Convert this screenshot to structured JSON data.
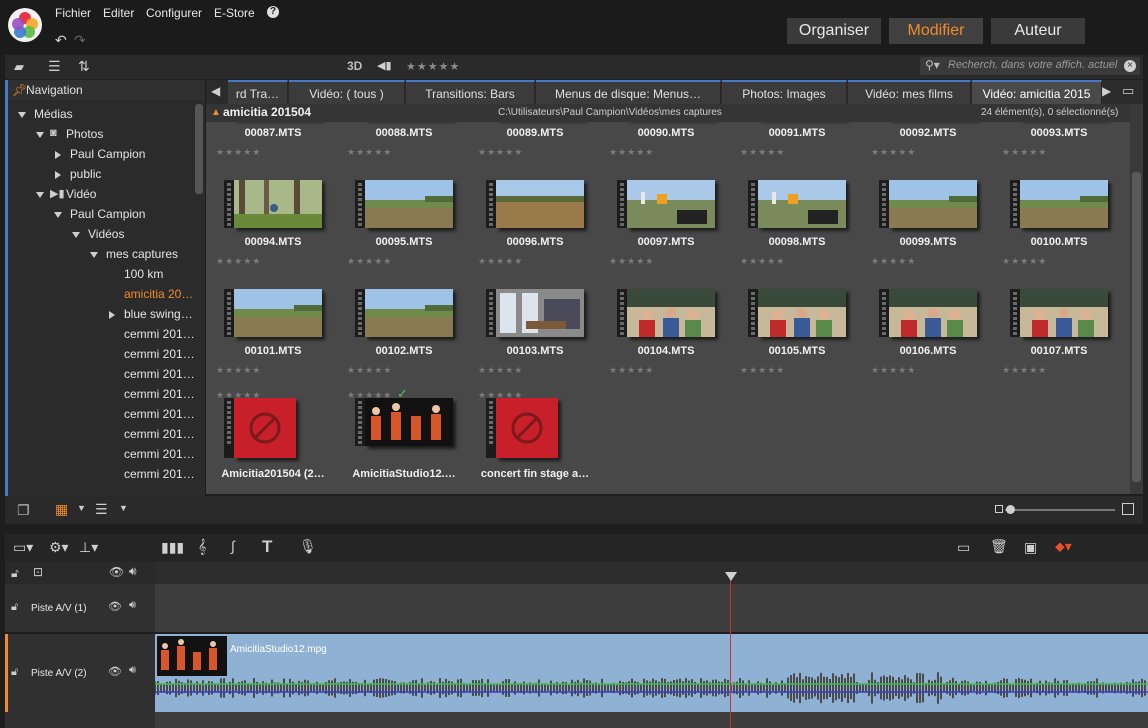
{
  "menu": [
    "Fichier",
    "Editer",
    "Configurer",
    "E-Store"
  ],
  "modes": {
    "organiser": "Organiser",
    "modifier": "Modifier",
    "auteur": "Auteur"
  },
  "toolbar": {
    "label_3d": "3D",
    "stars": "★★★★★"
  },
  "search": {
    "placeholder": "Recherch. dans votre affich. actuel"
  },
  "navigation": {
    "title": "Navigation",
    "rows": [
      {
        "label": "Médias",
        "indent": 0,
        "expand": "down",
        "icon": "none"
      },
      {
        "label": "Photos",
        "indent": 1,
        "expand": "down",
        "icon": "camera-icon"
      },
      {
        "label": "Paul Campion",
        "indent": 2,
        "expand": "right",
        "icon": "none"
      },
      {
        "label": "public",
        "indent": 2,
        "expand": "right",
        "icon": "none"
      },
      {
        "label": "Vidéo",
        "indent": 1,
        "expand": "down",
        "icon": "video-icon"
      },
      {
        "label": "Paul Campion",
        "indent": 2,
        "expand": "down",
        "icon": "none"
      },
      {
        "label": "Vidéos",
        "indent": 3,
        "expand": "down",
        "icon": "none"
      },
      {
        "label": "mes captures",
        "indent": 4,
        "expand": "down",
        "icon": "none"
      },
      {
        "label": "100 km",
        "indent": 5,
        "expand": "none",
        "icon": "none"
      },
      {
        "label": "amicitia 20…",
        "indent": 5,
        "expand": "none",
        "icon": "none",
        "selected": true
      },
      {
        "label": "blue swing…",
        "indent": 5,
        "expand": "right",
        "icon": "none"
      },
      {
        "label": "cemmi 201…",
        "indent": 5,
        "expand": "none",
        "icon": "none"
      },
      {
        "label": "cemmi 201…",
        "indent": 5,
        "expand": "none",
        "icon": "none"
      },
      {
        "label": "cemmi 201…",
        "indent": 5,
        "expand": "none",
        "icon": "none"
      },
      {
        "label": "cemmi 201…",
        "indent": 5,
        "expand": "none",
        "icon": "none"
      },
      {
        "label": "cemmi 201…",
        "indent": 5,
        "expand": "none",
        "icon": "none"
      },
      {
        "label": "cemmi 201…",
        "indent": 5,
        "expand": "none",
        "icon": "none"
      },
      {
        "label": "cemmi 201…",
        "indent": 5,
        "expand": "none",
        "icon": "none"
      },
      {
        "label": "cemmi 201…",
        "indent": 5,
        "expand": "none",
        "icon": "none"
      }
    ]
  },
  "tabs": [
    {
      "label": "rd Tra…"
    },
    {
      "label": "Vidéo: ( tous )"
    },
    {
      "label": "Transitions: Bars"
    },
    {
      "label": "Menus de disque: Menus…"
    },
    {
      "label": "Photos: Images"
    },
    {
      "label": "Vidéo: mes films"
    },
    {
      "label": "Vidéo: amicitia 2015",
      "active": true
    }
  ],
  "pathbar": {
    "folder": "amicitia 201504",
    "path": "C:\\Utilisateurs\\Paul Campion\\Vidéos\\mes captures",
    "count": "24 élément(s), 0 sélectionné(s)"
  },
  "grid": {
    "rows": [
      [
        {
          "name": "00087.MTS",
          "thumb": "crowd"
        },
        {
          "name": "00088.MTS",
          "thumb": "red"
        },
        {
          "name": "00089.MTS",
          "thumb": "red"
        },
        {
          "name": "00090.MTS",
          "thumb": "field"
        },
        {
          "name": "00091.MTS",
          "thumb": "field"
        },
        {
          "name": "00092.MTS",
          "thumb": "crowd"
        },
        {
          "name": "00093.MTS",
          "thumb": "crowd"
        }
      ],
      [
        {
          "name": "00094.MTS",
          "thumb": "trees"
        },
        {
          "name": "00095.MTS",
          "thumb": "field"
        },
        {
          "name": "00096.MTS",
          "thumb": "brown"
        },
        {
          "name": "00097.MTS",
          "thumb": "road"
        },
        {
          "name": "00098.MTS",
          "thumb": "road"
        },
        {
          "name": "00099.MTS",
          "thumb": "field"
        },
        {
          "name": "00100.MTS",
          "thumb": "field"
        }
      ],
      [
        {
          "name": "00101.MTS",
          "thumb": "field"
        },
        {
          "name": "00102.MTS",
          "thumb": "field"
        },
        {
          "name": "00103.MTS",
          "thumb": "room"
        },
        {
          "name": "00104.MTS",
          "thumb": "class"
        },
        {
          "name": "00105.MTS",
          "thumb": "class"
        },
        {
          "name": "00106.MTS",
          "thumb": "class"
        },
        {
          "name": "00107.MTS",
          "thumb": "class"
        }
      ],
      [
        {
          "name": "Amicitia201504 (2…",
          "thumb": "blocked"
        },
        {
          "name": "AmicitiaStudio12.…",
          "thumb": "stage",
          "checked": true
        },
        {
          "name": "concert fin stage a…",
          "thumb": "blocked"
        }
      ]
    ],
    "stars": "★★★★★"
  },
  "timeline": {
    "tracks": [
      {
        "name": "Piste A/V (1)"
      },
      {
        "name": "Piste A/V (2)"
      }
    ],
    "clip": {
      "name": "AmicitiaStudio12.mpg"
    }
  },
  "colors": {
    "accent": "#f08c2a",
    "blue": "#4a78c8"
  }
}
